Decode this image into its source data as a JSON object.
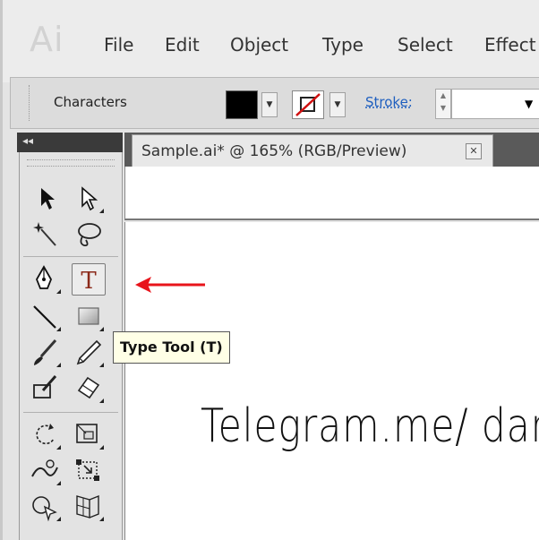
{
  "app": {
    "logo_text": "Ai"
  },
  "menu": [
    "File",
    "Edit",
    "Object",
    "Type",
    "Select",
    "Effect"
  ],
  "control_bar": {
    "characters_label": "Characters",
    "fill_color": "#000000",
    "stroke_label": "Stroke:"
  },
  "document": {
    "tab_title": "Sample.ai* @ 165% (RGB/Preview)",
    "close_symbol": "✕"
  },
  "tools": [
    {
      "name": "selection-tool",
      "icon": "arrow-icon"
    },
    {
      "name": "direct-selection-tool",
      "icon": "hollow-arrow-icon"
    },
    {
      "name": "magic-wand-tool",
      "icon": "magic-wand-icon"
    },
    {
      "name": "lasso-tool",
      "icon": "lasso-icon"
    },
    {
      "name": "pen-tool",
      "icon": "pen-nib-icon"
    },
    {
      "name": "type-tool",
      "icon": "type-t-icon",
      "glyph": "T"
    },
    {
      "name": "line-segment-tool",
      "icon": "line-icon"
    },
    {
      "name": "rectangle-tool",
      "icon": "rectangle-icon"
    },
    {
      "name": "paintbrush-tool",
      "icon": "brush-icon"
    },
    {
      "name": "pencil-tool",
      "icon": "pencil-icon"
    },
    {
      "name": "blob-brush-tool",
      "icon": "blob-brush-icon"
    },
    {
      "name": "eraser-tool",
      "icon": "eraser-icon"
    },
    {
      "name": "rotate-tool",
      "icon": "rotate-icon"
    },
    {
      "name": "scale-tool",
      "icon": "scale-icon"
    },
    {
      "name": "warp-tool",
      "icon": "warp-icon"
    },
    {
      "name": "free-transform-tool",
      "icon": "free-transform-icon"
    },
    {
      "name": "shape-builder-tool",
      "icon": "shape-builder-icon"
    },
    {
      "name": "perspective-grid-tool",
      "icon": "perspective-grid-icon"
    }
  ],
  "tooltip": {
    "text": "Type Tool (T)"
  },
  "canvas": {
    "watermark_text": "Telegram.me/ danc"
  },
  "colors": {
    "annotation_arrow": "#e8141b",
    "type_glyph": "#8b2a1a"
  }
}
